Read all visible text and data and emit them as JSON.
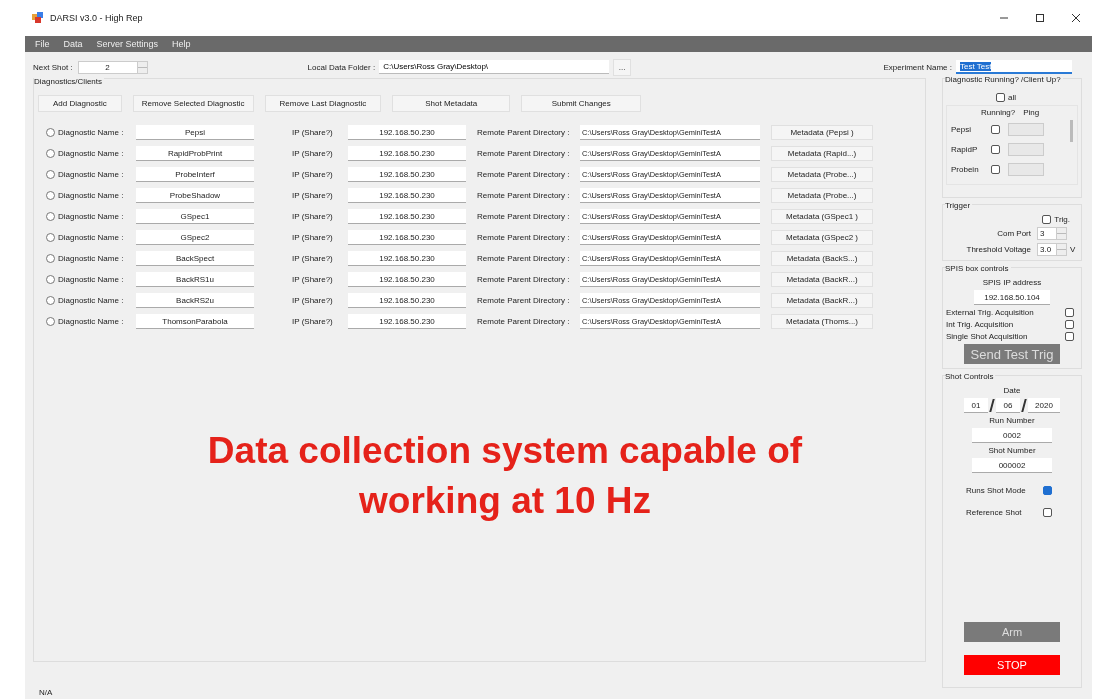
{
  "window": {
    "title": "DARSI v3.0 - High Rep"
  },
  "menu": [
    "File",
    "Data",
    "Server Settings",
    "Help"
  ],
  "next_shot": {
    "label": "Next Shot :",
    "value": "2"
  },
  "local_data_folder": {
    "label": "Local Data Folder :",
    "value": "C:\\Users\\Ross Gray\\Desktop\\",
    "browse": "..."
  },
  "experiment_name": {
    "label": "Experiment Name :",
    "value": "Test Test",
    "selected": true
  },
  "diagnostics": {
    "title": "Diagnostics/Clients",
    "buttons": [
      "Add Diagnostic",
      "Remove Selected Diagnostic",
      "Remove Last Diagnostic",
      "Shot Metadata",
      "Submit Changes"
    ],
    "rows": [
      {
        "selected": false,
        "name_label": "Diagnostic Name :",
        "name": "Pepsi",
        "ip_label": "IP (Share?)",
        "ip": "192.168.50.230",
        "dir_label": "Remote Parent Directory :",
        "dir": "C:\\Users\\Ross Gray\\Desktop\\GeminiTestA",
        "metadata": "Metadata (Pepsi )"
      },
      {
        "selected": false,
        "name_label": "Diagnostic Name :",
        "name": "RapidProbPrint",
        "ip_label": "IP (Share?)",
        "ip": "192.168.50.230",
        "dir_label": "Remote Parent Directory :",
        "dir": "C:\\Users\\Ross Gray\\Desktop\\GeminiTestA",
        "metadata": "Metadata (Rapid...)"
      },
      {
        "selected": false,
        "name_label": "Diagnostic Name :",
        "name": "ProbeInterf",
        "ip_label": "IP (Share?)",
        "ip": "192.168.50.230",
        "dir_label": "Remote Parent Directory :",
        "dir": "C:\\Users\\Ross Gray\\Desktop\\GeminiTestA",
        "metadata": "Metadata (Probe...)"
      },
      {
        "selected": false,
        "name_label": "Diagnostic Name :",
        "name": "ProbeShadow",
        "ip_label": "IP (Share?)",
        "ip": "192.168.50.230",
        "dir_label": "Remote Parent Directory :",
        "dir": "C:\\Users\\Ross Gray\\Desktop\\GeminiTestA",
        "metadata": "Metadata (Probe...)"
      },
      {
        "selected": false,
        "name_label": "Diagnostic Name :",
        "name": "GSpec1",
        "ip_label": "IP (Share?)",
        "ip": "192.168.50.230",
        "dir_label": "Remote Parent Directory :",
        "dir": "C:\\Users\\Ross Gray\\Desktop\\GeminiTestA",
        "metadata": "Metadata (GSpec1 )"
      },
      {
        "selected": false,
        "name_label": "Diagnostic Name :",
        "name": "GSpec2",
        "ip_label": "IP (Share?)",
        "ip": "192.168.50.230",
        "dir_label": "Remote Parent Directory :",
        "dir": "C:\\Users\\Ross Gray\\Desktop\\GeminiTestA",
        "metadata": "Metadata (GSpec2 )"
      },
      {
        "selected": false,
        "name_label": "Diagnostic Name :",
        "name": "BackSpect",
        "ip_label": "IP (Share?)",
        "ip": "192.168.50.230",
        "dir_label": "Remote Parent Directory :",
        "dir": "C:\\Users\\Ross Gray\\Desktop\\GeminiTestA",
        "metadata": "Metadata (BackS...)"
      },
      {
        "selected": false,
        "name_label": "Diagnostic Name :",
        "name": "BackRS1u",
        "ip_label": "IP (Share?)",
        "ip": "192.168.50.230",
        "dir_label": "Remote Parent Directory :",
        "dir": "C:\\Users\\Ross Gray\\Desktop\\GeminiTestA",
        "metadata": "Metadata (BackR...)"
      },
      {
        "selected": false,
        "name_label": "Diagnostic Name :",
        "name": "BackRS2u",
        "ip_label": "IP (Share?)",
        "ip": "192.168.50.230",
        "dir_label": "Remote Parent Directory :",
        "dir": "C:\\Users\\Ross Gray\\Desktop\\GeminiTestA",
        "metadata": "Metadata (BackR...)"
      },
      {
        "selected": false,
        "name_label": "Diagnostic Name :",
        "name": "ThomsonParabola",
        "ip_label": "IP (Share?)",
        "ip": "192.168.50.230",
        "dir_label": "Remote Parent Directory :",
        "dir": "C:\\Users\\Ross Gray\\Desktop\\GeminiTestA",
        "metadata": "Metadata (Thoms...)"
      }
    ]
  },
  "status_group": {
    "title": "Diagnostic Running? /Client Up?",
    "all": {
      "label": "all",
      "checked": false
    },
    "headers": [
      "Running?",
      "Ping"
    ],
    "rows": [
      {
        "name": "Pepsi",
        "checked": false
      },
      {
        "name": "RapidP",
        "checked": false
      },
      {
        "name": "Probein",
        "checked": false
      }
    ]
  },
  "trigger": {
    "title": "Trigger",
    "trig": {
      "label": "Trig.",
      "checked": false
    },
    "com_port": {
      "label": "Com Port",
      "value": "3"
    },
    "threshold": {
      "label": "Threshold Voltage",
      "value": "3.0",
      "unit": "V"
    }
  },
  "spis": {
    "title": "SPIS box controls",
    "ip_label": "SPIS IP address",
    "ip": "192.168.50.104",
    "options": [
      {
        "label": "External Trig. Acquisition",
        "checked": false
      },
      {
        "label": "Int Trig. Acquisition",
        "checked": false
      },
      {
        "label": "Single Shot Acquisition",
        "checked": false
      }
    ],
    "send_button": {
      "label": "Send Test Trig",
      "disabled": true
    }
  },
  "shot_controls": {
    "title": "Shot Controls",
    "date_label": "Date",
    "date": [
      "01",
      "06",
      "2020"
    ],
    "run_label": "Run Number",
    "run": "0002",
    "shot_label": "Shot Number",
    "shot": "000002",
    "options": [
      {
        "label": "Runs Shot Mode",
        "checked": true
      },
      {
        "label": "Reference Shot",
        "checked": false
      }
    ],
    "arm": {
      "label": "Arm",
      "disabled": true
    },
    "stop": "STOP"
  },
  "status_bar": "N/A",
  "overlay_caption": [
    "Data collection system capable of",
    "working at 10 Hz"
  ]
}
